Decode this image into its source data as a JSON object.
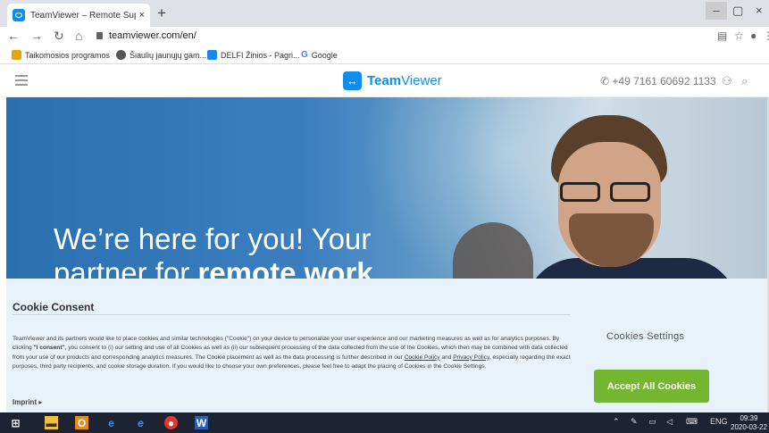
{
  "browser": {
    "tab_title": "TeamViewer – Remote Support, R",
    "tab_close": "×",
    "new_tab": "+",
    "url": "teamviewer.com/en/",
    "window_controls": {
      "minimize": "–",
      "maximize": "▢",
      "close": "×"
    }
  },
  "bookmarks": [
    {
      "label": "Taikomosios programos",
      "icon": "apps-grid-icon",
      "color": "#e8a317"
    },
    {
      "label": "Šiaulių jaunųjų gam...",
      "icon": "globe-icon",
      "color": "#555555"
    },
    {
      "label": "DELFI Žinios - Pagri...",
      "icon": "delfi-icon",
      "color": "#1e88e5"
    },
    {
      "label": "Google",
      "icon": "google-icon",
      "color": "#4285f4"
    }
  ],
  "site_header": {
    "brand_bold": "Team",
    "brand_light": "Viewer",
    "phone": "+49 7161 60692 1133",
    "brand_color": "#0e8ee9"
  },
  "hero": {
    "headline_line1": "We’re here for you! Your",
    "headline_line2_prefix": "partner for ",
    "headline_line2_bold": "remote work"
  },
  "cookie": {
    "title": "Cookie Consent",
    "text_part1": "TeamViewer and its partners would like to place cookies and similar technologies (\"Cookie\") on your device to personalize your user experience and our marketing measures as well as for analytics purposes. By clicking ",
    "text_bold": "\"I consent\"",
    "text_part2": ", you consent to (i) our setting and use of all Cookies as well as (ii) our subsequent processing of the data collected from the use of the Cookies, which then may be combined with data collected from your use of our products and corresponding analytics measures. The Cookie placement as well as the data processing is further described in our ",
    "cookie_policy_link": "Cookie Policy",
    "and": " and ",
    "privacy_policy_link": "Privacy Policy",
    "text_part3": ", especially regarding the exact purposes, third party recipients, and cookie storage duration. If you would like to choose your own preferences, please feel free to adapt the placing of Cookies in the Cookie Settings.",
    "imprint": "Imprint",
    "imprint_arrow": "▸",
    "settings": "Cookies Settings",
    "accept": "Accept All Cookies",
    "accept_color": "#74b630"
  },
  "taskbar": {
    "language": "ENG",
    "time": "09:39",
    "date": "2020-03-22",
    "apps": [
      "windows-start-icon",
      "file-explorer-icon",
      "outlook-icon",
      "edge-icon",
      "internet-explorer-icon",
      "chrome-icon",
      "word-icon"
    ]
  }
}
